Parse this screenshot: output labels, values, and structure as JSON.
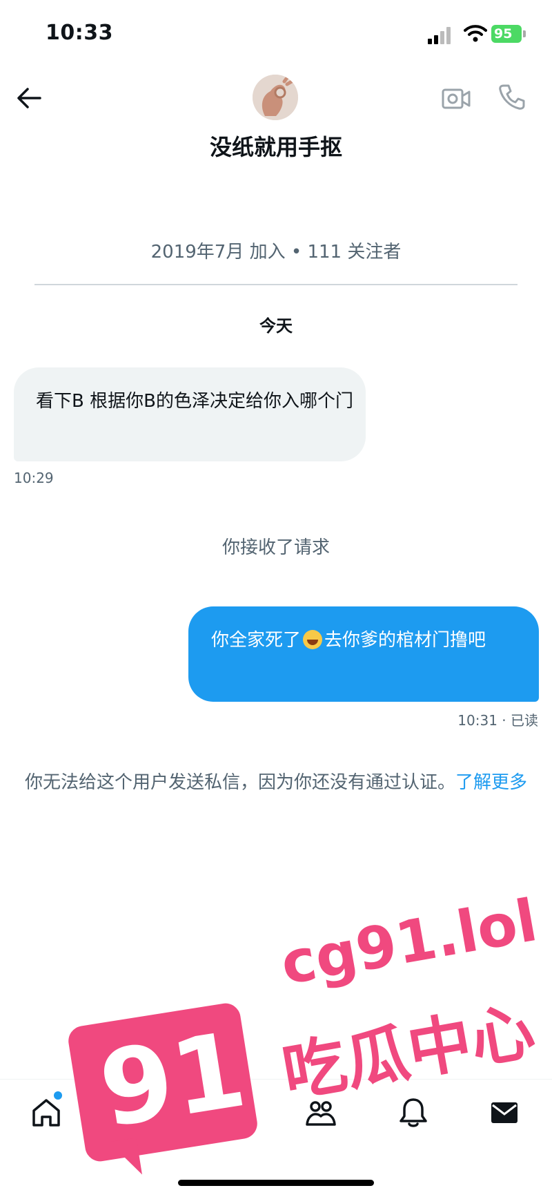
{
  "status_bar": {
    "time": "10:33",
    "battery": "95"
  },
  "header": {
    "name": "没纸就用手抠"
  },
  "profile": {
    "joined": "2019年7月 加入 • 111 关注者"
  },
  "conversation": {
    "date_divider": "今天",
    "incoming": {
      "text": "看下B 根据你B的色泽决定给你入哪个门",
      "time": "10:29"
    },
    "system_accepted": "你接收了请求",
    "outgoing": {
      "text_before": "你全家死了",
      "emoji": "😂",
      "text_after": "去你爹的棺材门撸吧",
      "meta": "10:31 · 已读"
    },
    "notice": {
      "text": "你无法给这个用户发送私信，因为你还没有通过认证。",
      "link": "了解更多"
    }
  },
  "nav": {
    "items": [
      "home-icon",
      "search-icon",
      "grok-icon",
      "communities-icon",
      "notifications-icon",
      "messages-icon"
    ],
    "accent": "#1d9bf0"
  },
  "watermark": {
    "badge": "91",
    "url": "cg91.lol",
    "label": "吃瓜中心",
    "color": "#f0497f"
  }
}
